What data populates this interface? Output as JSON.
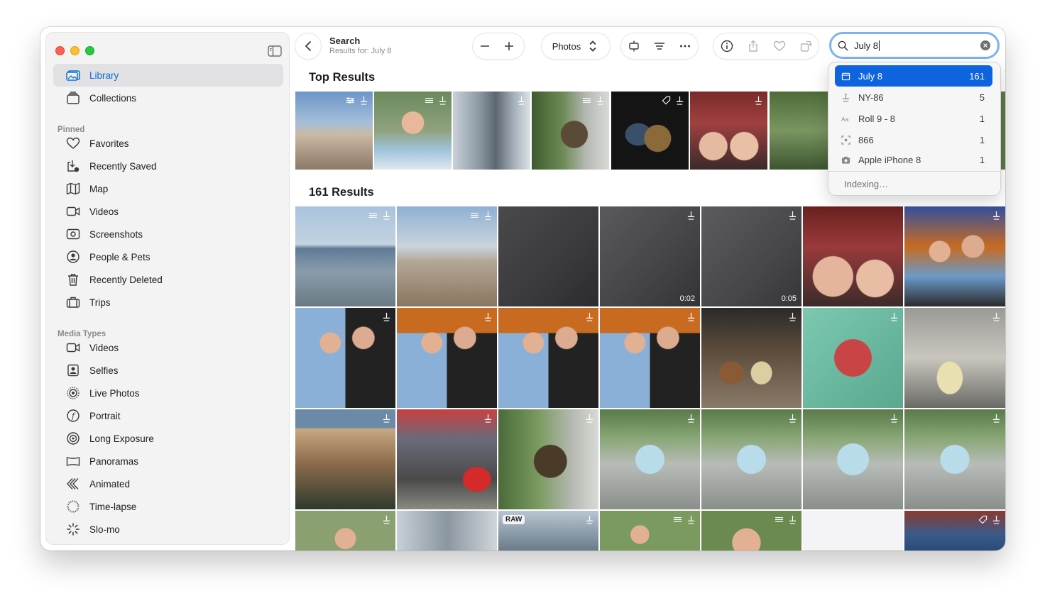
{
  "sidebar": {
    "library": "Library",
    "collections": "Collections",
    "pinned_header": "Pinned",
    "pinned": [
      {
        "label": "Favorites",
        "icon": "heart-icon"
      },
      {
        "label": "Recently Saved",
        "icon": "recently-saved-icon"
      },
      {
        "label": "Map",
        "icon": "map-icon"
      },
      {
        "label": "Videos",
        "icon": "video-icon"
      },
      {
        "label": "Screenshots",
        "icon": "screenshot-icon"
      },
      {
        "label": "People & Pets",
        "icon": "person-icon"
      },
      {
        "label": "Recently Deleted",
        "icon": "trash-icon"
      },
      {
        "label": "Trips",
        "icon": "suitcase-icon"
      }
    ],
    "media_header": "Media Types",
    "media": [
      {
        "label": "Videos",
        "icon": "video-icon"
      },
      {
        "label": "Selfies",
        "icon": "selfie-icon"
      },
      {
        "label": "Live Photos",
        "icon": "live-photo-icon"
      },
      {
        "label": "Portrait",
        "icon": "portrait-icon"
      },
      {
        "label": "Long Exposure",
        "icon": "long-exposure-icon"
      },
      {
        "label": "Panoramas",
        "icon": "panorama-icon"
      },
      {
        "label": "Animated",
        "icon": "animated-icon"
      },
      {
        "label": "Time-lapse",
        "icon": "timelapse-icon"
      },
      {
        "label": "Slo-mo",
        "icon": "slomo-icon"
      }
    ]
  },
  "toolbar": {
    "title": "Search",
    "subtitle": "Results for: July 8",
    "view_select": "Photos"
  },
  "search": {
    "value": "July 8"
  },
  "suggestions": [
    {
      "label": "July 8",
      "count": "161",
      "icon": "calendar-icon"
    },
    {
      "label": "NY-86",
      "count": "5",
      "icon": "keyword-icon"
    },
    {
      "label": "Roll 9 - 8",
      "count": "1",
      "icon": "text-icon"
    },
    {
      "label": "866",
      "count": "1",
      "icon": "scan-text-icon"
    },
    {
      "label": "Apple iPhone 8",
      "count": "1",
      "icon": "camera-icon"
    }
  ],
  "indexing": "Indexing…",
  "top_results_title": "Top Results",
  "results_title": "161 Results",
  "colors": {
    "accent": "#0d64de",
    "sidebar_bg": "#f3f3f4"
  },
  "thumbs": {
    "d1": "0:02",
    "d2": "0:05",
    "raw": "RAW"
  }
}
